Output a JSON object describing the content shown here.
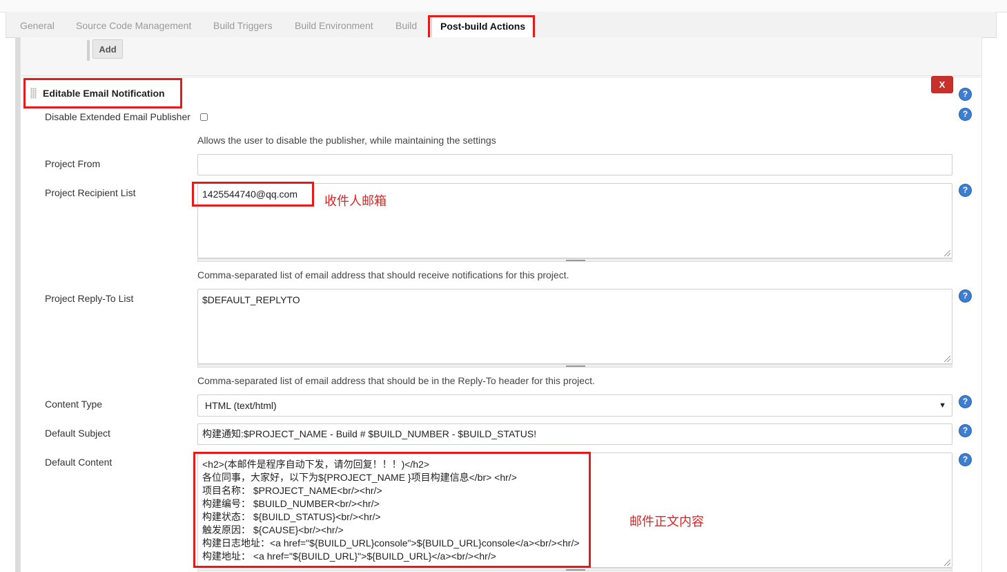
{
  "tabs": [
    {
      "label": "General"
    },
    {
      "label": "Source Code Management"
    },
    {
      "label": "Build Triggers"
    },
    {
      "label": "Build Environment"
    },
    {
      "label": "Build"
    },
    {
      "label": "Post-build Actions"
    }
  ],
  "toolbar": {
    "add_label": "Add"
  },
  "section": {
    "title": "Editable Email Notification",
    "delete_label": "X"
  },
  "help_label": "?",
  "fields": {
    "disable": {
      "label": "Disable Extended Email Publisher",
      "hint": "Allows the user to disable the publisher, while maintaining the settings"
    },
    "project_from": {
      "label": "Project From",
      "value": ""
    },
    "recipients": {
      "label": "Project Recipient List",
      "value": "1425544740@qq.com",
      "hint": "Comma-separated list of email address that should receive notifications for this project."
    },
    "reply_to": {
      "label": "Project Reply-To List",
      "value": "$DEFAULT_REPLYTO",
      "hint": "Comma-separated list of email address that should be in the Reply-To header for this project."
    },
    "content_type": {
      "label": "Content Type",
      "value": "HTML (text/html)",
      "arrow": "▼"
    },
    "subject": {
      "label": "Default Subject",
      "value": "构建通知:$PROJECT_NAME - Build # $BUILD_NUMBER - $BUILD_STATUS!"
    },
    "content": {
      "label": "Default Content",
      "lines": [
        "<h2>(本邮件是程序自动下发，请勿回复！！！)</h2>",
        "各位同事，大家好，以下为${PROJECT_NAME }项目构建信息</br> <hr/>",
        "项目名称： $PROJECT_NAME<br/><hr/>",
        "构建编号： $BUILD_NUMBER<br/><hr/>",
        "构建状态： ${BUILD_STATUS}<br/><hr/>",
        "触发原因： ${CAUSE}<br/><hr/>",
        "构建日志地址：<a href=\"${BUILD_URL}console\">${BUILD_URL}console</a><br/><hr/>",
        "构建地址： <a href=\"${BUILD_URL}\">${BUILD_URL}</a><br/><hr/>"
      ]
    }
  },
  "annotations": {
    "recipient": "收件人邮箱",
    "content": "邮件正文内容",
    "highlight_color": "#e31b1b"
  }
}
